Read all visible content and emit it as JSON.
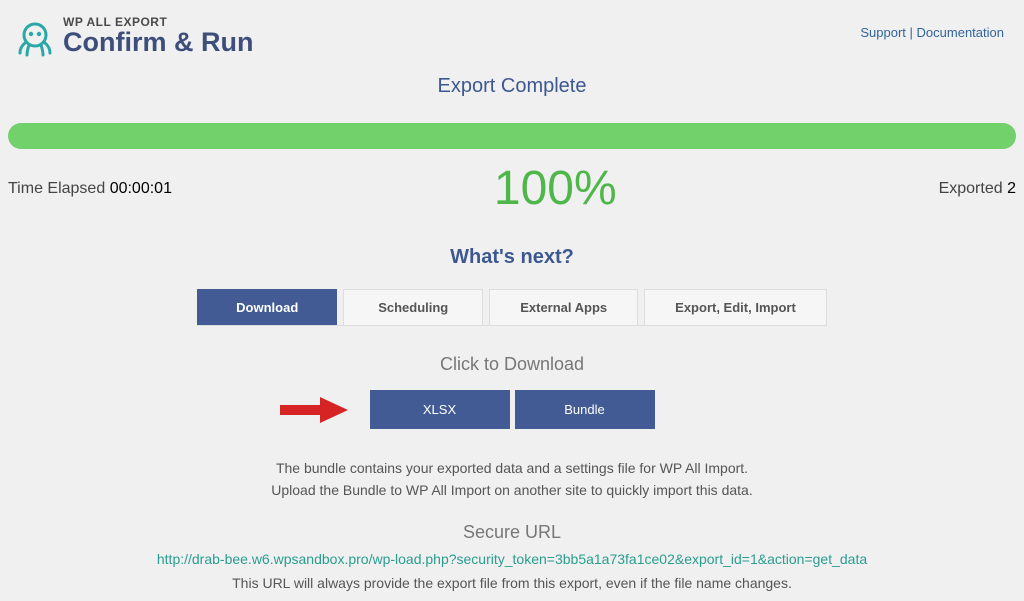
{
  "header": {
    "brand": "WP ALL EXPORT",
    "page_title": "Confirm & Run",
    "support_link": "Support",
    "docs_link": "Documentation",
    "link_divider": "|"
  },
  "status": {
    "title": "Export Complete",
    "time_elapsed_label": "Time Elapsed",
    "time_elapsed_value": "00:00:01",
    "progress_percent": "100%",
    "exported_label": "Exported",
    "exported_count": "2"
  },
  "next": {
    "title": "What's next?",
    "tabs": [
      {
        "label": "Download"
      },
      {
        "label": "Scheduling"
      },
      {
        "label": "External Apps"
      },
      {
        "label": "Export, Edit, Import"
      }
    ]
  },
  "download": {
    "click_title": "Click to Download",
    "xlsx_label": "XLSX",
    "bundle_label": "Bundle",
    "bundle_desc_line1": "The bundle contains your exported data and a settings file for WP All Import.",
    "bundle_desc_line2": "Upload the Bundle to WP All Import on another site to quickly import this data."
  },
  "secure": {
    "title": "Secure URL",
    "url": "http://drab-bee.w6.wpsandbox.pro/wp-load.php?security_token=3bb5a1a73fa1ce02&export_id=1&action=get_data",
    "desc": "This URL will always provide the export file from this export, even if the file name changes."
  }
}
